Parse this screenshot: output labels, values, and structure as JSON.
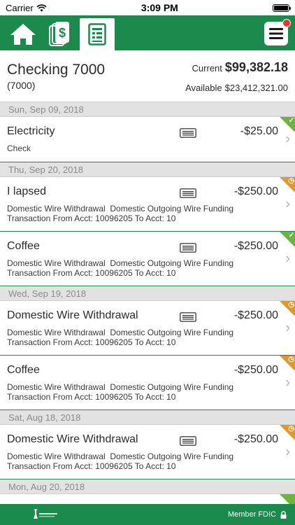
{
  "status_bar": {
    "carrier": "Carrier",
    "time": "3:09 PM"
  },
  "nav": {
    "tabs": [
      {
        "icon": "home-icon"
      },
      {
        "icon": "money-stack-icon"
      },
      {
        "icon": "ledger-icon",
        "active": true
      }
    ],
    "menu_icon": "hamburger-icon",
    "notification": true
  },
  "account": {
    "name": "Checking 7000",
    "number": "(7000)",
    "current_label": "Current",
    "current_amount": "$99,382.18",
    "available_label": "Available",
    "available_amount": "$23,412,321.00"
  },
  "sections": [
    {
      "date": "Sun, Sep 09, 2018",
      "items": [
        {
          "title": "Electricity",
          "desc1": "Check",
          "desc2": "",
          "amount": "-$25.00",
          "status": "cleared",
          "has_card": true,
          "size": "short"
        }
      ]
    },
    {
      "date": "Thu, Sep 20, 2018",
      "items": [
        {
          "title": "I lapsed",
          "desc1": "Domestic Wire Withdrawal  Domestic Outgoing Wire Funding",
          "desc2": "Transaction From Acct: 10096205 To Acct: 10",
          "amount": "-$250.00",
          "status": "pending",
          "has_card": true,
          "size": "tall"
        },
        {
          "title": "Coffee",
          "desc1": "Domestic Wire Withdrawal  Domestic Outgoing Wire Funding",
          "desc2": "Transaction From Acct: 10096205 To Acct: 10",
          "amount": "-$250.00",
          "status": "cleared",
          "has_card": true,
          "size": "tall"
        }
      ]
    },
    {
      "date": "Wed, Sep 19, 2018",
      "items": [
        {
          "title": "Domestic Wire Withdrawal",
          "desc1": "Domestic Wire Withdrawal  Domestic Outgoing Wire Funding",
          "desc2": "Transaction From Acct: 10096205 To Acct: 10",
          "amount": "-$250.00",
          "status": "pending",
          "has_card": true,
          "size": "tall"
        },
        {
          "title": "Coffee",
          "desc1": "Domestic Wire Withdrawal  Domestic Outgoing Wire Funding",
          "desc2": "Transaction From Acct: 10096205 To Acct: 10",
          "amount": "-$250.00",
          "status": "pending",
          "has_card": false,
          "size": "tall"
        }
      ]
    },
    {
      "date": "Sat, Aug 18, 2018",
      "items": [
        {
          "title": "Domestic Wire Withdrawal",
          "desc1": "Domestic Wire Withdrawal  Domestic Outgoing Wire Funding",
          "desc2": "Transaction From Acct: 10096205 To Acct: 10",
          "amount": "-$250.00",
          "status": "pending",
          "has_card": true,
          "size": "tall"
        }
      ]
    },
    {
      "date": "Mon, Aug 20, 2018",
      "items": []
    }
  ],
  "footer": {
    "member_fdic": "Member FDIC",
    "lock_icon": "lock-icon",
    "logo_icon": "bank-logo-icon"
  },
  "colors": {
    "brand_green": "#1b8a4c",
    "cleared_green": "#6cb33f",
    "pending_orange": "#e0972b",
    "notification_red": "#e8372c"
  }
}
